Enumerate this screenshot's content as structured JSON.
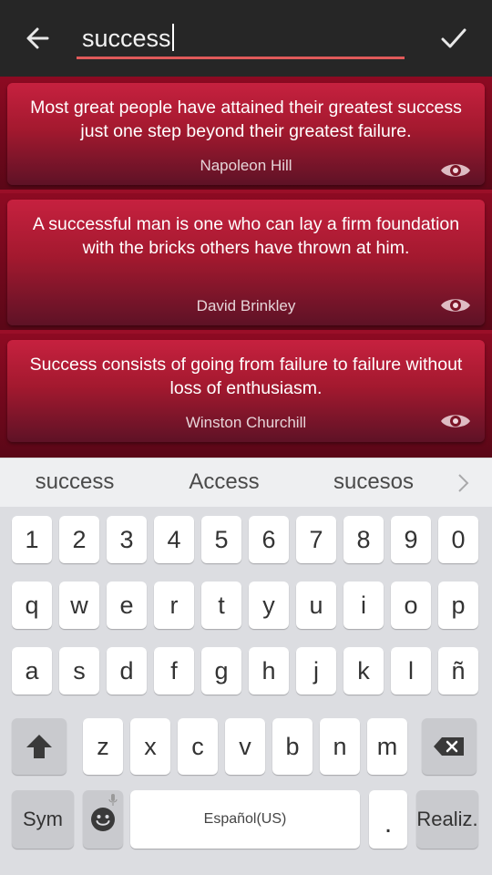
{
  "search": {
    "value": "success"
  },
  "quotes": [
    {
      "text": "Most great people have attained their greatest success just one step beyond their greatest failure.",
      "author": "Napoleon Hill"
    },
    {
      "text": "A successful man is one who can lay a firm foundation with the bricks others have thrown at him.",
      "author": "David Brinkley"
    },
    {
      "text": "Success consists of going from failure to failure without loss of enthusiasm.",
      "author": "Winston Churchill"
    }
  ],
  "suggestions": [
    "success",
    "Access",
    "sucesos"
  ],
  "keyboard": {
    "numbers": [
      "1",
      "2",
      "3",
      "4",
      "5",
      "6",
      "7",
      "8",
      "9",
      "0"
    ],
    "row1": [
      "q",
      "w",
      "e",
      "r",
      "t",
      "y",
      "u",
      "i",
      "o",
      "p"
    ],
    "row2": [
      "a",
      "s",
      "d",
      "f",
      "g",
      "h",
      "j",
      "k",
      "l",
      "ñ"
    ],
    "row3": [
      "z",
      "x",
      "c",
      "v",
      "b",
      "n",
      "m"
    ],
    "sym_label": "Sym",
    "space_label": "Español(US)",
    "period_label": ".",
    "action_label": "Realiz."
  },
  "icons": {
    "back": "arrow-left-icon",
    "confirm": "check-icon",
    "eye": "eye-icon",
    "shift": "shift-icon",
    "backspace": "backspace-icon",
    "emoji": "emoji-icon",
    "mic": "mic-icon",
    "chevron": "chevron-right-icon"
  },
  "colors": {
    "accent": "#e05a5a",
    "card": "#c6213f",
    "background": "#9a0f28"
  }
}
